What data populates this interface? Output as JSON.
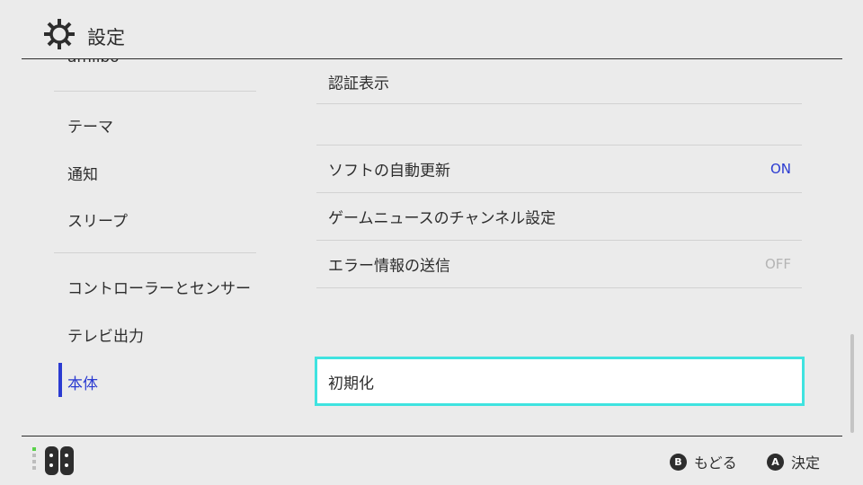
{
  "header": {
    "title": "設定",
    "icon": "gear-icon"
  },
  "sidebar": {
    "cut_item": "amiibo",
    "items": [
      {
        "label": "テーマ"
      },
      {
        "label": "通知"
      },
      {
        "label": "スリープ"
      },
      {
        "label": "コントローラーとセンサー"
      },
      {
        "label": "テレビ出力"
      },
      {
        "label": "本体",
        "active": true
      }
    ],
    "accent_color": "#2b3bd1"
  },
  "content": {
    "rows": [
      {
        "label": "認証表示",
        "value": ""
      },
      {
        "label": "",
        "value": ""
      },
      {
        "label": "ソフトの自動更新",
        "value": "ON"
      },
      {
        "label": "ゲームニュースのチャンネル設定",
        "value": ""
      },
      {
        "label": "エラー情報の送信",
        "value": "OFF"
      }
    ],
    "focused": {
      "label": "初期化"
    },
    "focus_color": "#3fe3e0"
  },
  "footer": {
    "controller_icon": "joycon-icon",
    "hints": [
      {
        "button": "B",
        "label": "もどる"
      },
      {
        "button": "A",
        "label": "決定"
      }
    ]
  }
}
